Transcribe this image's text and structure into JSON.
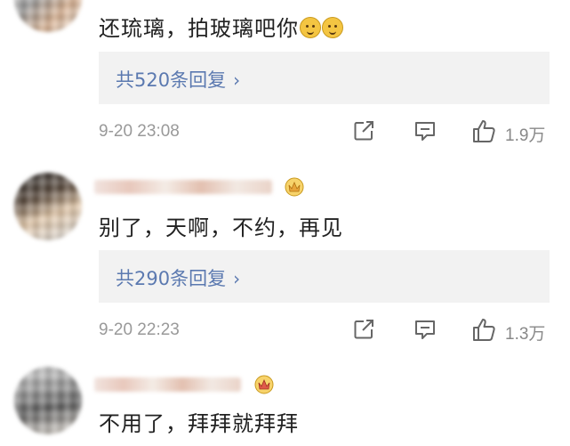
{
  "comments": [
    {
      "text": "还琉璃，拍玻璃吧你",
      "emoji": [
        "doge-emoji",
        "doge-emoji"
      ],
      "replies_label": "共520条回复",
      "timestamp": "9-20 23:08",
      "like_count": "1.9万"
    },
    {
      "text": "别了，天啊，不约，再见",
      "badge_icon": "vip-crown-icon",
      "replies_label": "共290条回复",
      "timestamp": "9-20 22:23",
      "like_count": "1.3万"
    },
    {
      "text": "不用了，拜拜就拜拜",
      "badge_icon": "vip-crown-icon"
    }
  ],
  "colors": {
    "link": "#5b79b0",
    "meta": "#999999",
    "reply_bg": "#f2f2f2",
    "text": "#222222"
  }
}
